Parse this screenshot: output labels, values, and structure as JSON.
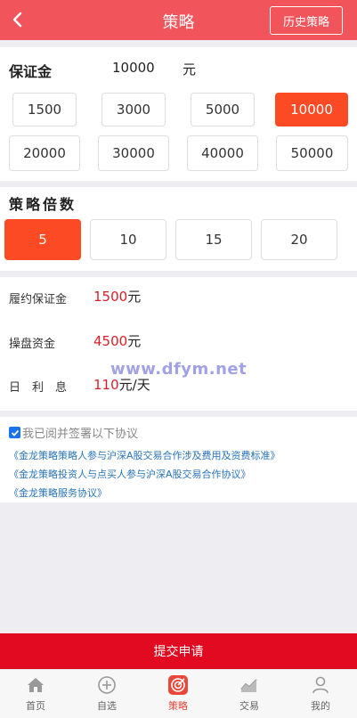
{
  "header": {
    "title": "策略",
    "history_button": "历史策略"
  },
  "deposit": {
    "label": "保证金",
    "value": "10000",
    "unit": "元",
    "options": [
      "1500",
      "3000",
      "5000",
      "10000",
      "20000",
      "30000",
      "40000",
      "50000"
    ],
    "selected": "10000"
  },
  "multiplier": {
    "label": "策略倍数",
    "options": [
      "5",
      "10",
      "15",
      "20"
    ],
    "selected": "5"
  },
  "summary": {
    "margin_label": "履约保证金",
    "margin_value": "1500",
    "margin_unit": "元",
    "fund_label": "操盘资金",
    "fund_value": "4500",
    "fund_unit": "元",
    "interest_label": "日　利　息",
    "interest_value": "110",
    "interest_unit": "元/天"
  },
  "watermark": "www.dfym.net",
  "agreement": {
    "checked": true,
    "text": "我已阅并签署以下协议",
    "links": [
      "《金龙策略策略人参与沪深A股交易合作涉及费用及资费标准》",
      "《金龙策略投资人与点买人参与沪深A股交易合作协议》",
      "《金龙策略服务协议》"
    ]
  },
  "submit_label": "提交申请",
  "tabbar": {
    "items": [
      {
        "label": "首页",
        "icon": "home-icon"
      },
      {
        "label": "自选",
        "icon": "plus-circle-icon"
      },
      {
        "label": "策略",
        "icon": "target-icon"
      },
      {
        "label": "交易",
        "icon": "chart-icon"
      },
      {
        "label": "我的",
        "icon": "user-icon"
      }
    ],
    "active": "策略"
  },
  "colors": {
    "header": "#f2545b",
    "accent": "#fb4a24",
    "submit": "#e10a20",
    "value_red": "#d8202a",
    "link": "#2873b5"
  }
}
